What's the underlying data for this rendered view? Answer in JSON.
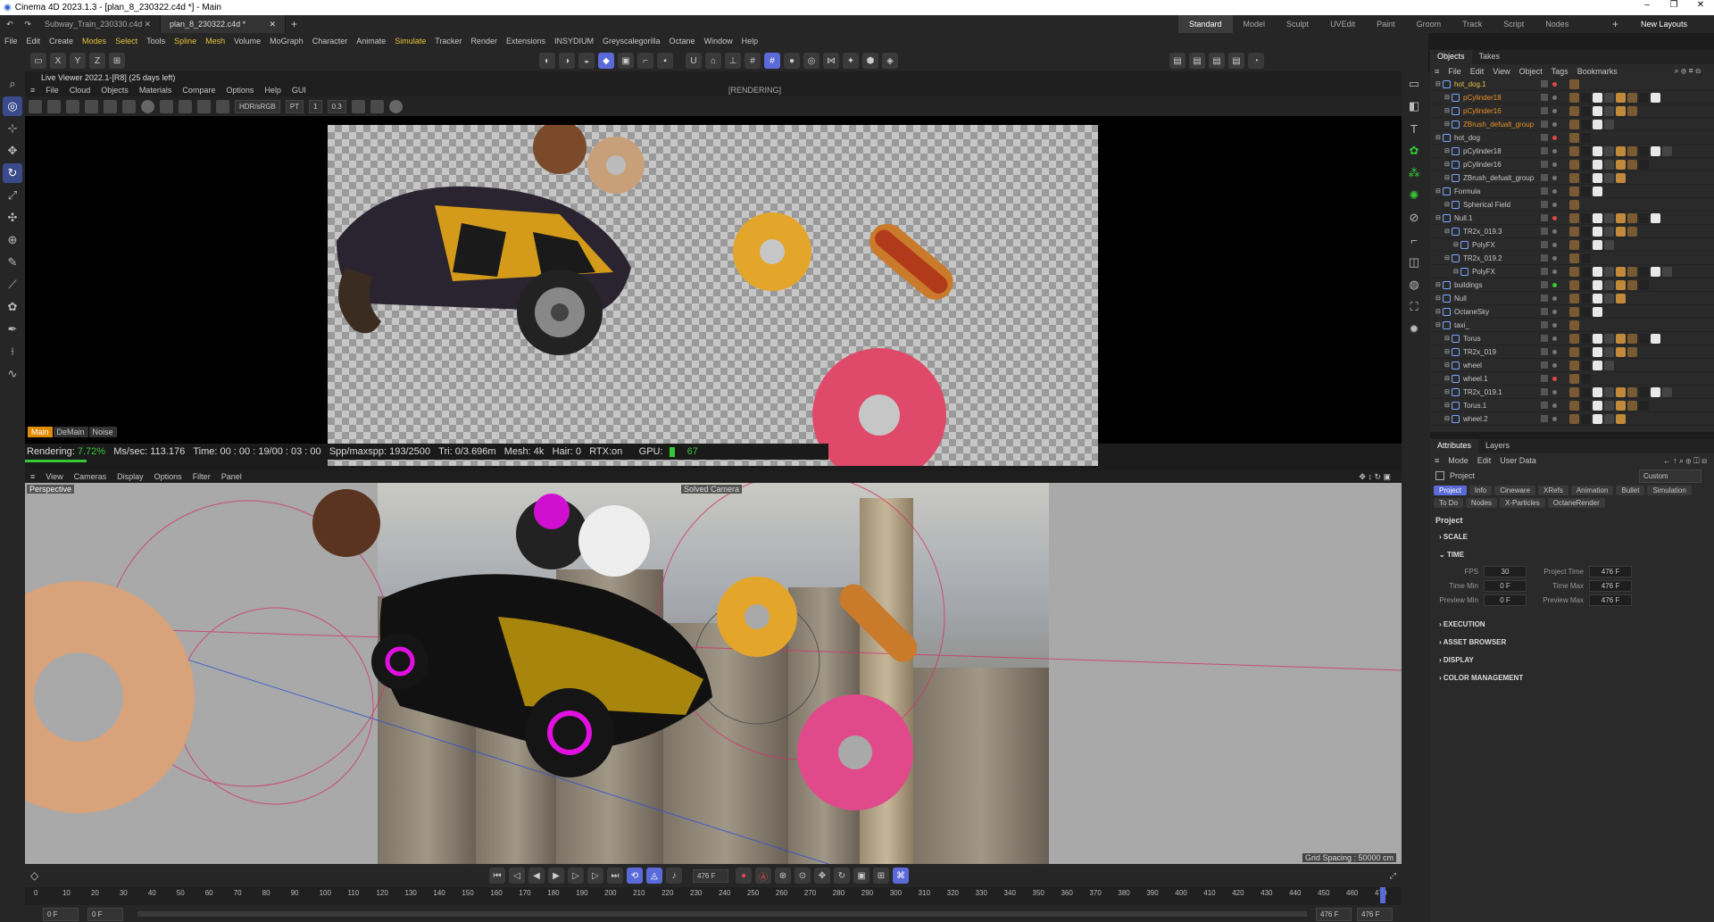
{
  "window": {
    "title": "Cinema 4D 2023.1.3 - [plan_8_230322.c4d *] - Main"
  },
  "doc_tabs": [
    {
      "label": "Subway_Train_230330.c4d"
    },
    {
      "label": "plan_8_230322.c4d *"
    }
  ],
  "layouts": [
    "Standard",
    "Model",
    "Sculpt",
    "UVEdit",
    "Paint",
    "Groom",
    "Track",
    "Script",
    "Nodes"
  ],
  "new_layouts": "New Layouts",
  "menu": [
    "File",
    "Edit",
    "Create",
    "Modes",
    "Select",
    "Tools",
    "Spline",
    "Mesh",
    "Volume",
    "MoGraph",
    "Character",
    "Animate",
    "Simulate",
    "Tracker",
    "Render",
    "Extensions",
    "INSYDIUM",
    "Greyscalegorilla",
    "Octane",
    "Window",
    "Help"
  ],
  "live_viewer": {
    "title": "Live Viewer 2022.1-[R8] (25 days left)",
    "menu": [
      "File",
      "Cloud",
      "Objects",
      "Materials",
      "Compare",
      "Options",
      "Help",
      "GUI"
    ],
    "state": "[RENDERING]",
    "colorspace": "HDR/sRGB",
    "kernel": "PT",
    "value1": "1",
    "value2": "0.3",
    "tabs": [
      "Main",
      "DeMain",
      "Noise"
    ],
    "status": {
      "rendering_label": "Rendering:",
      "rendering_pct": "7.72%",
      "mssec_label": "Ms/sec:",
      "mssec": "113.176",
      "time_label": "Time:",
      "time": "00 : 00 : 19/00 : 03 : 00",
      "spp_label": "Spp/maxspp:",
      "spp": "193/2500",
      "tri_label": "Tri:",
      "tri": "0/3.696m",
      "mesh_label": "Mesh:",
      "mesh": "4k",
      "hair_label": "Hair:",
      "hair": "0",
      "rtx_label": "RTX:",
      "rtx": "on",
      "gpu_label": "GPU:",
      "gpu": "67"
    },
    "progress": 0.0772
  },
  "viewport": {
    "menu": [
      "View",
      "Cameras",
      "Display",
      "Options",
      "Filter",
      "Panel"
    ],
    "name": "Perspective",
    "camera": "Solved Camera",
    "grid": "Grid Spacing : 50000 cm"
  },
  "timeline": {
    "current_frame": "476 F",
    "start": "0 F",
    "start2": "0 F",
    "end": "476 F",
    "end2": "476 F",
    "ticks": [
      "0",
      "10",
      "20",
      "30",
      "40",
      "50",
      "60",
      "70",
      "80",
      "90",
      "100",
      "110",
      "120",
      "130",
      "140",
      "150",
      "160",
      "170",
      "180",
      "190",
      "200",
      "210",
      "220",
      "230",
      "240",
      "250",
      "260",
      "270",
      "280",
      "290",
      "300",
      "310",
      "320",
      "330",
      "340",
      "350",
      "360",
      "370",
      "380",
      "390",
      "400",
      "410",
      "420",
      "430",
      "440",
      "450",
      "460",
      "470"
    ]
  },
  "objects_panel": {
    "tabs": [
      "Objects",
      "Takes"
    ],
    "menu": [
      "File",
      "Edit",
      "View",
      "Object",
      "Tags",
      "Bookmarks"
    ],
    "items": [
      {
        "name": "hot_dog.1",
        "indent": 0,
        "color": "#e8c04a",
        "dot": "#e04848"
      },
      {
        "name": "pCylinder18",
        "indent": 1,
        "color": "#e8912a",
        "dot": "#777"
      },
      {
        "name": "pCylinder16",
        "indent": 1,
        "color": "#e8912a",
        "dot": "#777"
      },
      {
        "name": "ZBrush_defualt_group",
        "indent": 1,
        "color": "#e8912a",
        "dot": "#777"
      },
      {
        "name": "hot_dog",
        "indent": 0,
        "color": "#c8c8c8",
        "dot": "#e04848"
      },
      {
        "name": "pCylinder18",
        "indent": 1,
        "color": "#c8c8c8",
        "dot": "#777"
      },
      {
        "name": "pCylinder16",
        "indent": 1,
        "color": "#c8c8c8",
        "dot": "#777"
      },
      {
        "name": "ZBrush_defualt_group",
        "indent": 1,
        "color": "#c8c8c8",
        "dot": "#777"
      },
      {
        "name": "Formula",
        "indent": 0,
        "color": "#c8c8c8",
        "dot": "#777"
      },
      {
        "name": "Spherical Field",
        "indent": 1,
        "color": "#c8c8c8",
        "dot": "#777"
      },
      {
        "name": "Null.1",
        "indent": 0,
        "color": "#c8c8c8",
        "dot": "#e04848"
      },
      {
        "name": "TR2x_019.3",
        "indent": 1,
        "color": "#c8c8c8",
        "dot": "#777"
      },
      {
        "name": "PolyFX",
        "indent": 2,
        "color": "#c8c8c8",
        "dot": "#777"
      },
      {
        "name": "TR2x_019.2",
        "indent": 1,
        "color": "#c8c8c8",
        "dot": "#777"
      },
      {
        "name": "PolyFX",
        "indent": 2,
        "color": "#c8c8c8",
        "dot": "#777"
      },
      {
        "name": "buildings",
        "indent": 0,
        "color": "#c8c8c8",
        "dot": "#37c837"
      },
      {
        "name": "Null",
        "indent": 0,
        "color": "#c8c8c8",
        "dot": "#777"
      },
      {
        "name": "OctaneSky",
        "indent": 0,
        "color": "#c8c8c8",
        "dot": "#777"
      },
      {
        "name": "taxi_",
        "indent": 0,
        "color": "#c8c8c8",
        "dot": "#777"
      },
      {
        "name": "Torus",
        "indent": 1,
        "color": "#c8c8c8",
        "dot": "#777"
      },
      {
        "name": "TR2x_019",
        "indent": 1,
        "color": "#c8c8c8",
        "dot": "#777"
      },
      {
        "name": "wheel",
        "indent": 1,
        "color": "#c8c8c8",
        "dot": "#777"
      },
      {
        "name": "wheel.1",
        "indent": 1,
        "color": "#c8c8c8",
        "dot": "#e04848"
      },
      {
        "name": "TR2x_019.1",
        "indent": 1,
        "color": "#c8c8c8",
        "dot": "#777"
      },
      {
        "name": "Torus.1",
        "indent": 1,
        "color": "#c8c8c8",
        "dot": "#777"
      },
      {
        "name": "wheel.2",
        "indent": 1,
        "color": "#c8c8c8",
        "dot": "#777"
      }
    ]
  },
  "attributes": {
    "tabs": [
      "Attributes",
      "Layers"
    ],
    "menu": [
      "Mode",
      "Edit",
      "User Data"
    ],
    "object": "Project",
    "preset": "Custom",
    "subtabs1": [
      "Project",
      "Info",
      "Cineware",
      "XRefs",
      "Animation",
      "Bullet"
    ],
    "subtabs2": [
      "Simulation",
      "To Do",
      "Nodes",
      "X-Particles",
      "OctaneRender"
    ],
    "heading": "Project",
    "sections": [
      "SCALE",
      "TIME",
      "EXECUTION",
      "ASSET BROWSER",
      "DISPLAY",
      "COLOR MANAGEMENT"
    ],
    "time": {
      "fps_label": "FPS",
      "fps": "30",
      "ptime_label": "Project Time",
      "ptime": "476 F",
      "tmin_label": "Time Min",
      "tmin": "0 F",
      "tmax_label": "Time Max",
      "tmax": "476 F",
      "pmin_label": "Preview Min",
      "pmin": "0 F",
      "pmax_label": "Preview Max",
      "pmax": "476 F"
    }
  },
  "colors": {
    "accent": "#5a6ad8",
    "highlight": "#e6c23a",
    "green": "#37c837",
    "orange": "#e08a00"
  }
}
